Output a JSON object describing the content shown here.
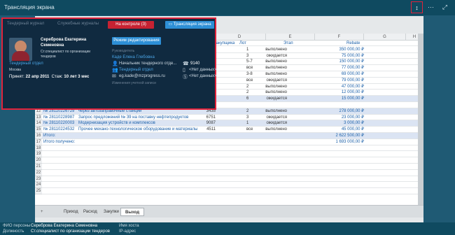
{
  "window": {
    "title": "Трансляция экрана",
    "btn_resize": "↕",
    "btn_more": "⋯",
    "btn_expand": "⤢"
  },
  "sheet": {
    "columns": [
      "",
      "C",
      "D",
      "E",
      "F",
      "G",
      "H"
    ],
    "header_row": {
      "c": "Закупщика",
      "d": "Лот",
      "e": "Этап",
      "f": "Rebate"
    },
    "rows": [
      {
        "n": "",
        "a": "",
        "c": "2354",
        "d": "1",
        "e": "выполнено",
        "f": "350 000,00 ₽"
      },
      {
        "n": "",
        "a": "",
        "c": "7689",
        "d": "3",
        "e": "ожидается",
        "f": "75 000,00 ₽"
      },
      {
        "n": "",
        "a": "",
        "c": "4532",
        "d": "5-7",
        "e": "выполнено",
        "f": "150 000,00 ₽"
      },
      {
        "n": "",
        "a": "",
        "c": "2333",
        "d": "все",
        "e": "выполнено",
        "f": "77 000,00 ₽"
      },
      {
        "n": "",
        "a": "",
        "c": "3236",
        "d": "3-8",
        "e": "выполнено",
        "f": "69 000,00 ₽"
      },
      {
        "n": "",
        "a": "",
        "c": "7690",
        "d": "все",
        "e": "ожидается",
        "f": "79 000,00 ₽"
      },
      {
        "n": "",
        "a": "",
        "c": "6533",
        "d": "2",
        "e": "выполнено",
        "f": "47 000,00 ₽"
      },
      {
        "n": "",
        "a": "",
        "c": "1232",
        "d": "2",
        "e": "выполнено",
        "f": "12 000,00 ₽"
      },
      {
        "n": "10",
        "a": "№ 28110223421",
        "b": "Поставка переносных средств видеонаблюдения",
        "c": "1254",
        "d": "6",
        "e": "ожидается",
        "f": "15 000,00 ₽"
      },
      {
        "n": "11",
        "a": "",
        "b": "Поставка  бензина автомобильного и дизельного топлива",
        "c": "",
        "d": "",
        "e": "",
        "f": ""
      },
      {
        "n": "12",
        "a": "№ 28110226729",
        "b": "через автозаправочные станции",
        "c": "3435",
        "d": "2",
        "e": "выполнено",
        "f": "278 000,00 ₽"
      },
      {
        "n": "13",
        "a": "№ 28110228987",
        "b": "Запрос предложений № 39 на поставку нефтепродуктов",
        "c": "6751",
        "d": "3",
        "e": "ожидается",
        "f": "23 000,00 ₽"
      },
      {
        "n": "14",
        "a": "№ 28110220003",
        "b": "Модернизация устройств и комплексов",
        "c": "9087",
        "d": "1",
        "e": "ожидается",
        "f": "3 000,00 ₽"
      },
      {
        "n": "15",
        "a": "№ 28110224532",
        "b": "Прочее механо-технологическое оборудование и материалы",
        "c": "4511",
        "d": "все",
        "e": "выполнено",
        "f": "45 000,00 ₽"
      },
      {
        "n": "16",
        "a": "Итого:",
        "b": "",
        "c": "",
        "d": "",
        "e": "",
        "f": "2 622 500,00 ₽"
      },
      {
        "n": "17",
        "a": "Итого получено:",
        "b": "",
        "c": "",
        "d": "",
        "e": "",
        "f": "1 693 000,00 ₽"
      },
      {
        "n": "18",
        "a": "",
        "b": "",
        "c": "",
        "d": "",
        "e": "",
        "f": ""
      },
      {
        "n": "19",
        "a": "",
        "b": "",
        "c": "",
        "d": "",
        "e": "",
        "f": ""
      },
      {
        "n": "20",
        "a": "",
        "b": "",
        "c": "",
        "d": "",
        "e": "",
        "f": ""
      },
      {
        "n": "21",
        "a": "",
        "b": "",
        "c": "",
        "d": "",
        "e": "",
        "f": ""
      },
      {
        "n": "22",
        "a": "",
        "b": "",
        "c": "",
        "d": "",
        "e": "",
        "f": ""
      },
      {
        "n": "23",
        "a": "",
        "b": "",
        "c": "",
        "d": "",
        "e": "",
        "f": ""
      },
      {
        "n": "24",
        "a": "",
        "b": "",
        "c": "",
        "d": "",
        "e": "",
        "f": ""
      },
      {
        "n": "25",
        "a": "",
        "b": "",
        "c": "",
        "d": "",
        "e": "",
        "f": ""
      }
    ],
    "tabs": [
      "Приход",
      "Расход",
      "Закупки",
      "Выход"
    ],
    "add_tab": "+"
  },
  "card": {
    "tab_left": "Тендерный журнал",
    "tab_mid": "Служебные журналы",
    "btn_control": "На контроле (3)",
    "btn_broadcast": "Трансляция экрана",
    "name_line1": "Сереброва Екатерина",
    "name_line2": "Семеновна",
    "position_line1": "Ст.специалист по организации",
    "position_line2": "тендеров",
    "dept": "Тендерный отдел",
    "city": "Москва",
    "hired_label": "Принят:",
    "hired_date": "22 апр 2011",
    "tenure_label": "Стаж:",
    "tenure": "10 лет 3 мес",
    "btn_edit": "Режим редактирования",
    "manager_label": "Руководитель",
    "manager_name": "Каде Елена Глебовна",
    "manager_title": "Начальник тендерного отде...",
    "phone": "9140",
    "manager_dept": "Тендерный отдел",
    "no_data1": "<Нет данных>",
    "email": "eg.kade@mzprogress.ru",
    "no_data2": "<Нет данных>",
    "last_entry": "Изменения учетной записи"
  },
  "footer": {
    "fio_label": "ФИО персоны",
    "fio": "Сереброва Екатерина Семеновна",
    "pos_label": "Должность",
    "pos": "Ст.специалист по организации тендеров",
    "host_label": "Имя хоста",
    "ip_label": "IP-адрес"
  }
}
